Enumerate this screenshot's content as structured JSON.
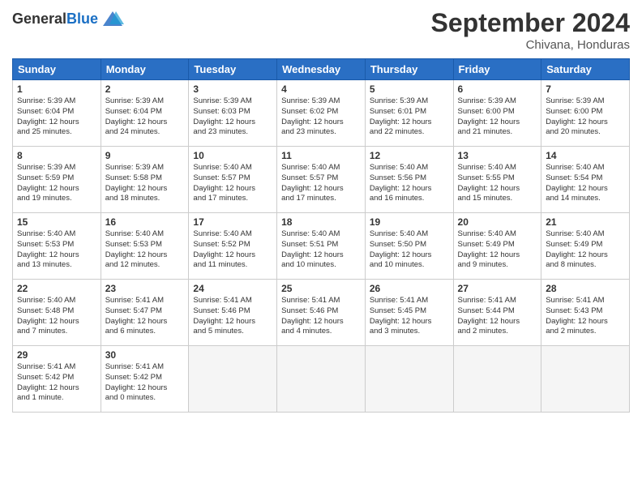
{
  "logo": {
    "line1": "General",
    "line2": "Blue"
  },
  "title": "September 2024",
  "location": "Chivana, Honduras",
  "headers": [
    "Sunday",
    "Monday",
    "Tuesday",
    "Wednesday",
    "Thursday",
    "Friday",
    "Saturday"
  ],
  "weeks": [
    [
      {
        "day": "1",
        "info": "Sunrise: 5:39 AM\nSunset: 6:04 PM\nDaylight: 12 hours\nand 25 minutes."
      },
      {
        "day": "2",
        "info": "Sunrise: 5:39 AM\nSunset: 6:04 PM\nDaylight: 12 hours\nand 24 minutes."
      },
      {
        "day": "3",
        "info": "Sunrise: 5:39 AM\nSunset: 6:03 PM\nDaylight: 12 hours\nand 23 minutes."
      },
      {
        "day": "4",
        "info": "Sunrise: 5:39 AM\nSunset: 6:02 PM\nDaylight: 12 hours\nand 23 minutes."
      },
      {
        "day": "5",
        "info": "Sunrise: 5:39 AM\nSunset: 6:01 PM\nDaylight: 12 hours\nand 22 minutes."
      },
      {
        "day": "6",
        "info": "Sunrise: 5:39 AM\nSunset: 6:00 PM\nDaylight: 12 hours\nand 21 minutes."
      },
      {
        "day": "7",
        "info": "Sunrise: 5:39 AM\nSunset: 6:00 PM\nDaylight: 12 hours\nand 20 minutes."
      }
    ],
    [
      {
        "day": "8",
        "info": "Sunrise: 5:39 AM\nSunset: 5:59 PM\nDaylight: 12 hours\nand 19 minutes."
      },
      {
        "day": "9",
        "info": "Sunrise: 5:39 AM\nSunset: 5:58 PM\nDaylight: 12 hours\nand 18 minutes."
      },
      {
        "day": "10",
        "info": "Sunrise: 5:40 AM\nSunset: 5:57 PM\nDaylight: 12 hours\nand 17 minutes."
      },
      {
        "day": "11",
        "info": "Sunrise: 5:40 AM\nSunset: 5:57 PM\nDaylight: 12 hours\nand 17 minutes."
      },
      {
        "day": "12",
        "info": "Sunrise: 5:40 AM\nSunset: 5:56 PM\nDaylight: 12 hours\nand 16 minutes."
      },
      {
        "day": "13",
        "info": "Sunrise: 5:40 AM\nSunset: 5:55 PM\nDaylight: 12 hours\nand 15 minutes."
      },
      {
        "day": "14",
        "info": "Sunrise: 5:40 AM\nSunset: 5:54 PM\nDaylight: 12 hours\nand 14 minutes."
      }
    ],
    [
      {
        "day": "15",
        "info": "Sunrise: 5:40 AM\nSunset: 5:53 PM\nDaylight: 12 hours\nand 13 minutes."
      },
      {
        "day": "16",
        "info": "Sunrise: 5:40 AM\nSunset: 5:53 PM\nDaylight: 12 hours\nand 12 minutes."
      },
      {
        "day": "17",
        "info": "Sunrise: 5:40 AM\nSunset: 5:52 PM\nDaylight: 12 hours\nand 11 minutes."
      },
      {
        "day": "18",
        "info": "Sunrise: 5:40 AM\nSunset: 5:51 PM\nDaylight: 12 hours\nand 10 minutes."
      },
      {
        "day": "19",
        "info": "Sunrise: 5:40 AM\nSunset: 5:50 PM\nDaylight: 12 hours\nand 10 minutes."
      },
      {
        "day": "20",
        "info": "Sunrise: 5:40 AM\nSunset: 5:49 PM\nDaylight: 12 hours\nand 9 minutes."
      },
      {
        "day": "21",
        "info": "Sunrise: 5:40 AM\nSunset: 5:49 PM\nDaylight: 12 hours\nand 8 minutes."
      }
    ],
    [
      {
        "day": "22",
        "info": "Sunrise: 5:40 AM\nSunset: 5:48 PM\nDaylight: 12 hours\nand 7 minutes."
      },
      {
        "day": "23",
        "info": "Sunrise: 5:41 AM\nSunset: 5:47 PM\nDaylight: 12 hours\nand 6 minutes."
      },
      {
        "day": "24",
        "info": "Sunrise: 5:41 AM\nSunset: 5:46 PM\nDaylight: 12 hours\nand 5 minutes."
      },
      {
        "day": "25",
        "info": "Sunrise: 5:41 AM\nSunset: 5:46 PM\nDaylight: 12 hours\nand 4 minutes."
      },
      {
        "day": "26",
        "info": "Sunrise: 5:41 AM\nSunset: 5:45 PM\nDaylight: 12 hours\nand 3 minutes."
      },
      {
        "day": "27",
        "info": "Sunrise: 5:41 AM\nSunset: 5:44 PM\nDaylight: 12 hours\nand 2 minutes."
      },
      {
        "day": "28",
        "info": "Sunrise: 5:41 AM\nSunset: 5:43 PM\nDaylight: 12 hours\nand 2 minutes."
      }
    ],
    [
      {
        "day": "29",
        "info": "Sunrise: 5:41 AM\nSunset: 5:42 PM\nDaylight: 12 hours\nand 1 minute."
      },
      {
        "day": "30",
        "info": "Sunrise: 5:41 AM\nSunset: 5:42 PM\nDaylight: 12 hours\nand 0 minutes."
      },
      null,
      null,
      null,
      null,
      null
    ]
  ]
}
